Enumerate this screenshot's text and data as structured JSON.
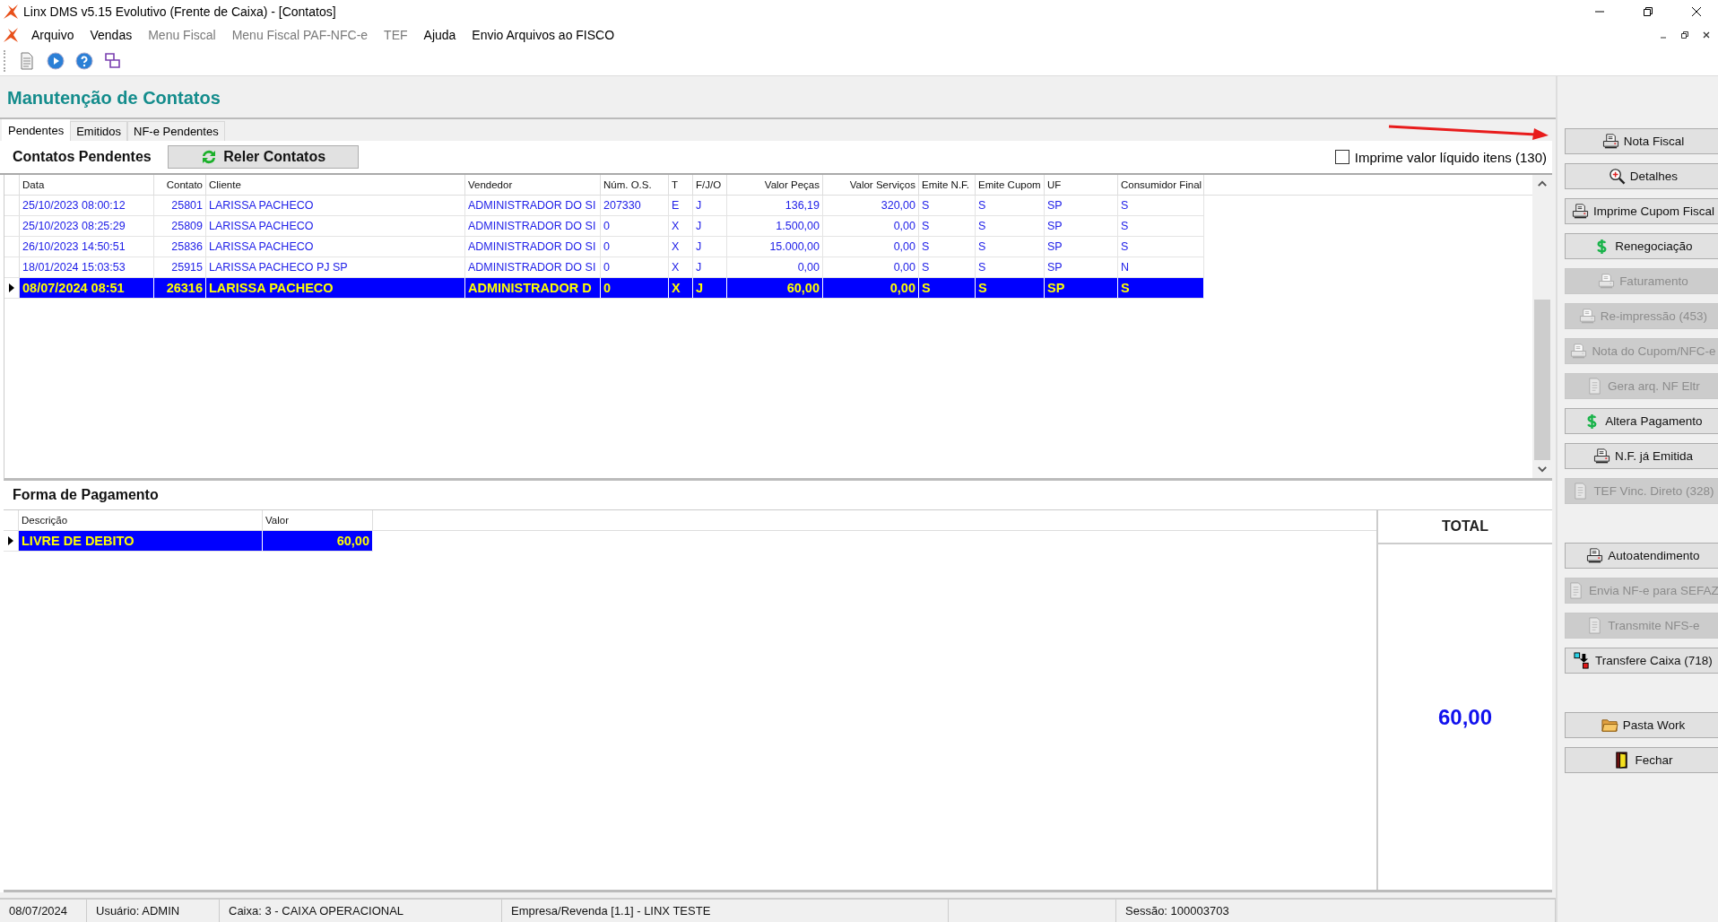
{
  "window": {
    "title": "Linx DMS v5.15 Evolutivo (Frente de Caixa) - [Contatos]"
  },
  "menu": [
    {
      "label": "Arquivo",
      "disabled": false
    },
    {
      "label": "Vendas",
      "disabled": false
    },
    {
      "label": "Menu Fiscal",
      "disabled": true
    },
    {
      "label": "Menu Fiscal PAF-NFC-e",
      "disabled": true
    },
    {
      "label": "TEF",
      "disabled": true
    },
    {
      "label": "Ajuda",
      "disabled": false
    },
    {
      "label": "Envio Arquivos ao FISCO",
      "disabled": false
    }
  ],
  "toolbar": [
    {
      "kind": "document"
    },
    {
      "kind": "play"
    },
    {
      "kind": "help"
    },
    {
      "kind": "windows"
    }
  ],
  "page_title": "Manutenção de Contatos",
  "tabs": [
    {
      "label": "Pendentes",
      "selected": true
    },
    {
      "label": "Emitidos",
      "selected": false
    },
    {
      "label": "NF-e Pendentes",
      "selected": false
    }
  ],
  "pending": {
    "title": "Contatos Pendentes",
    "reload_button": "Reler Contatos",
    "checkbox": {
      "label": "Imprime valor líquido itens (130)",
      "checked": false
    },
    "columns": [
      "Data",
      "Contato",
      "Cliente",
      "Vendedor",
      "Núm. O.S.",
      "T",
      "F/J/O",
      "Valor Peças",
      "Valor Serviços",
      "Emite N.F.",
      "Emite Cupom",
      "UF",
      "Consumidor Final"
    ],
    "rows": [
      {
        "selected": false,
        "cells": [
          "25/10/2023 08:00:12",
          "25801",
          "LARISSA PACHECO",
          "ADMINISTRADOR DO SI",
          "207330",
          "E",
          "J",
          "136,19",
          "320,00",
          "S",
          "S",
          "SP",
          "S"
        ]
      },
      {
        "selected": false,
        "cells": [
          "25/10/2023 08:25:29",
          "25809",
          "LARISSA PACHECO",
          "ADMINISTRADOR DO SI",
          "0",
          "X",
          "J",
          "1.500,00",
          "0,00",
          "S",
          "S",
          "SP",
          "S"
        ]
      },
      {
        "selected": false,
        "cells": [
          "26/10/2023 14:50:51",
          "25836",
          "LARISSA PACHECO",
          "ADMINISTRADOR DO SI",
          "0",
          "X",
          "J",
          "15.000,00",
          "0,00",
          "S",
          "S",
          "SP",
          "S"
        ]
      },
      {
        "selected": false,
        "cells": [
          "18/01/2024 15:03:53",
          "25915",
          "LARISSA PACHECO PJ SP",
          "ADMINISTRADOR DO SI",
          "0",
          "X",
          "J",
          "0,00",
          "0,00",
          "S",
          "S",
          "SP",
          "N"
        ]
      },
      {
        "selected": true,
        "cells": [
          "08/07/2024 08:51",
          "26316",
          "LARISSA PACHECO",
          "ADMINISTRADOR D",
          "0",
          "X",
          "J",
          "60,00",
          "0,00",
          "S",
          "S",
          "SP",
          "S"
        ]
      }
    ]
  },
  "payment": {
    "title": "Forma de Pagamento",
    "columns": [
      "Descrição",
      "Valor"
    ],
    "rows": [
      {
        "selected": true,
        "cells": [
          "LIVRE DE DEBITO",
          "60,00"
        ]
      }
    ],
    "total_label": "TOTAL",
    "total_value": "60,00"
  },
  "button_groups": [
    [
      {
        "label": "Nota Fiscal",
        "kind": "printer",
        "disabled": false
      },
      {
        "label": "Detalhes",
        "kind": "magnifier",
        "disabled": false
      },
      {
        "label": "Imprime Cupom Fiscal",
        "kind": "printer",
        "disabled": false
      },
      {
        "label": "Renegociação",
        "kind": "dollar",
        "disabled": false
      },
      {
        "label": "Faturamento",
        "kind": "printer",
        "disabled": true
      },
      {
        "label": "Re-impressão (453)",
        "kind": "printer",
        "disabled": true
      },
      {
        "label": "Nota do Cupom/NFC-e",
        "kind": "printer",
        "disabled": true
      },
      {
        "label": "Gera arq. NF Eltr",
        "kind": "document",
        "disabled": true
      },
      {
        "label": "Altera Pagamento",
        "kind": "dollar",
        "disabled": false
      },
      {
        "label": "N.F. já Emitida",
        "kind": "printer",
        "disabled": false
      },
      {
        "label": "TEF Vinc. Direto (328)",
        "kind": "document",
        "disabled": true
      }
    ],
    [
      {
        "label": "Autoatendimento",
        "kind": "printer",
        "disabled": false
      },
      {
        "label": "Envia NF-e para SEFAZ",
        "kind": "document",
        "disabled": true
      },
      {
        "label": "Transmite NFS-e",
        "kind": "document",
        "disabled": true
      },
      {
        "label": "Transfere Caixa (718)",
        "kind": "transfer",
        "disabled": false
      }
    ],
    [
      {
        "label": "Pasta Work",
        "kind": "folder",
        "disabled": false
      },
      {
        "label": "Fechar",
        "kind": "door",
        "disabled": false
      }
    ]
  ],
  "status_bar": [
    "08/07/2024",
    "Usuário: ADMIN",
    "Caixa: 3 - CAIXA OPERACIONAL",
    "Empresa/Revenda [1.1] - LINX TESTE",
    "Sessão: 100003703"
  ]
}
